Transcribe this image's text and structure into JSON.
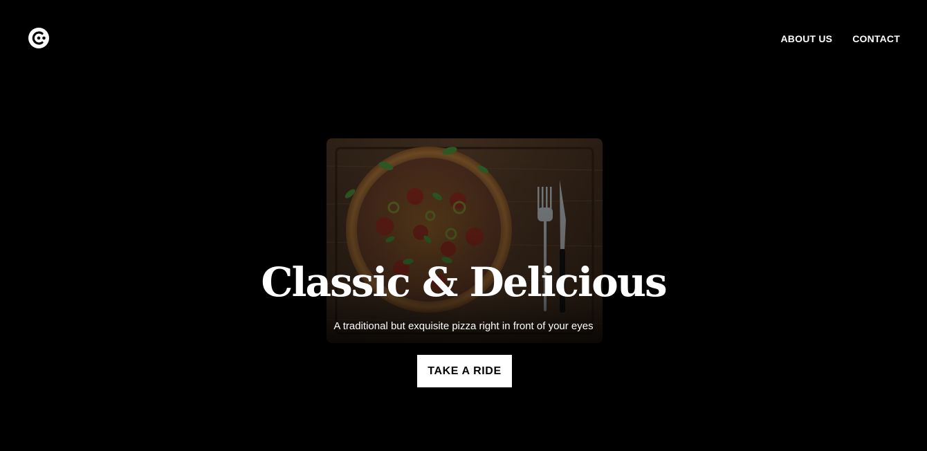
{
  "brand": {
    "logo_icon": "brand-logo-icon"
  },
  "nav": {
    "items": [
      {
        "label": "ABOUT US"
      },
      {
        "label": "CONTACT"
      }
    ]
  },
  "hero": {
    "image_icon": "pizza-on-cutting-board-photo",
    "title": "Classic & Delicious",
    "subtitle": "A traditional but exquisite pizza right in front of your eyes",
    "cta_label": "TAKE A RIDE"
  },
  "colors": {
    "background": "#000000",
    "text": "#ffffff",
    "button_bg": "#ffffff",
    "button_text": "#000000"
  }
}
